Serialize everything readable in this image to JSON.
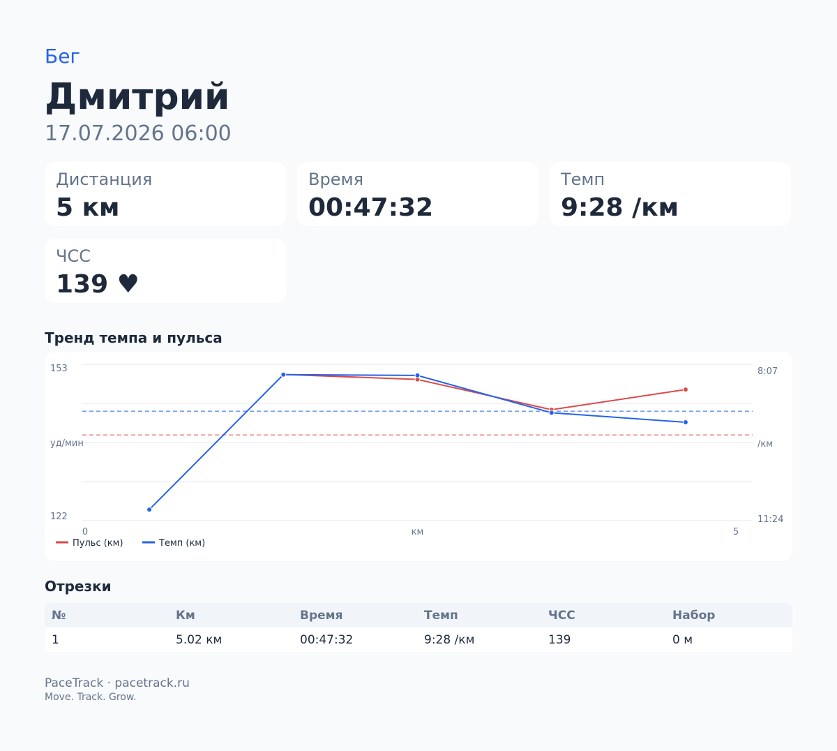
{
  "header": {
    "activity": "Бег",
    "athlete": "Дмитрий",
    "datetime": "17.07.2026 06:00"
  },
  "stats": [
    {
      "label": "Дистанция",
      "value": "5 км"
    },
    {
      "label": "Время",
      "value": "00:47:32"
    },
    {
      "label": "Темп",
      "value": "9:28 /км"
    },
    {
      "label": "ЧСС",
      "value": "139 ♥"
    }
  ],
  "chart_title": "Тренд темпа и пульса",
  "chart_data": {
    "type": "line",
    "x": [
      0.5,
      1.5,
      2.5,
      3.5,
      4.5
    ],
    "xlim": [
      0,
      5
    ],
    "xlabel": "км",
    "x_ticks": [
      "0",
      "5"
    ],
    "left_axis": {
      "label": "уд/мин",
      "ticks": [
        "153",
        "122"
      ],
      "ylim": [
        122,
        153
      ]
    },
    "right_axis": {
      "label": "/км",
      "ticks": [
        "8:07",
        "11:24"
      ],
      "range_sec": [
        487,
        684
      ]
    },
    "series": [
      {
        "name": "Пульс (км)",
        "color": "#dc4a4a",
        "axis": "left",
        "values": [
          null,
          151,
          150,
          144,
          148
        ],
        "average": 139
      },
      {
        "name": "Темп (км)",
        "color": "#2563eb",
        "axis": "right",
        "values_sec": [
          670,
          500,
          501,
          548,
          560
        ],
        "average_sec": 546
      }
    ],
    "grid": true,
    "legend": "bottom-left"
  },
  "segments": {
    "title": "Отрезки",
    "columns": [
      "№",
      "Км",
      "Время",
      "Темп",
      "ЧСС",
      "Набор"
    ],
    "rows": [
      [
        "1",
        "5.02 км",
        "00:47:32",
        "9:28 /км",
        "139",
        "0 м"
      ]
    ]
  },
  "footer": {
    "brand": "PaceTrack · pacetrack.ru",
    "tagline": "Move. Track. Grow."
  }
}
